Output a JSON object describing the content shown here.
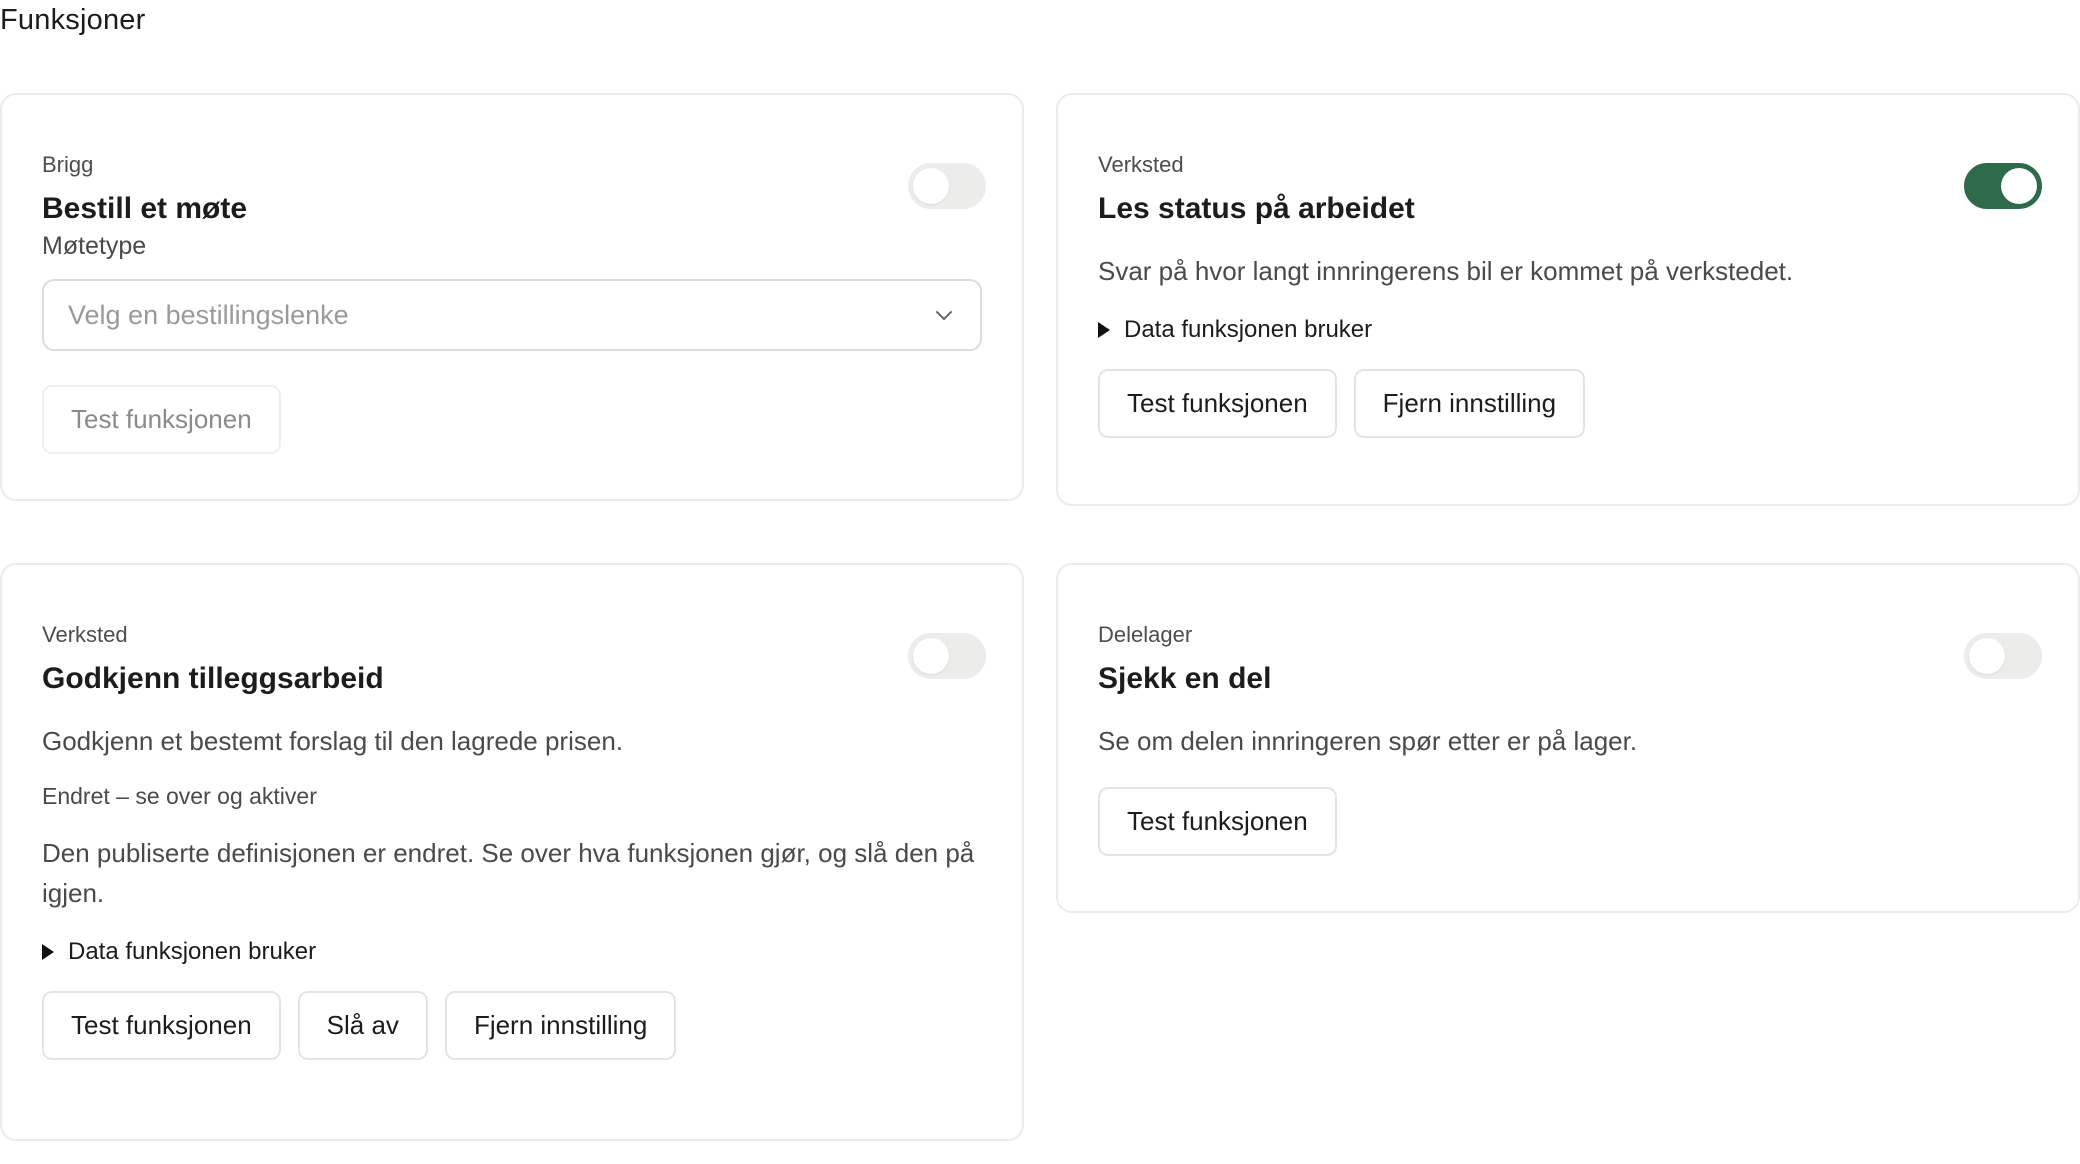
{
  "page": {
    "title": "Funksjoner"
  },
  "cards": [
    {
      "category": "Brigg",
      "title": "Bestill et møte",
      "enabled": false,
      "field_label": "Møtetype",
      "select_placeholder": "Velg en bestillingslenke",
      "buttons": [
        "Test funksjonen"
      ]
    },
    {
      "category": "Verksted",
      "title": "Les status på arbeidet",
      "enabled": true,
      "description": "Svar på hvor langt innringerens bil er kommet på verkstedet.",
      "data_toggle": "Data funksjonen bruker",
      "buttons": [
        "Test funksjonen",
        "Fjern innstilling"
      ]
    },
    {
      "category": "Verksted",
      "title": "Godkjenn tilleggsarbeid",
      "enabled": false,
      "description": "Godkjenn et bestemt forslag til den lagrede prisen.",
      "status_note": "Endret – se over og aktiver",
      "description_2": "Den publiserte definisjonen er endret. Se over hva funksjonen gjør, og slå den på igjen.",
      "data_toggle": "Data funksjonen bruker",
      "buttons": [
        "Test funksjonen",
        "Slå av",
        "Fjern innstilling"
      ]
    },
    {
      "category": "Delelager",
      "title": "Sjekk en del",
      "enabled": false,
      "description": "Se om delen innringeren spør etter er på lager.",
      "buttons": [
        "Test funksjonen"
      ]
    }
  ],
  "icons": {
    "dropdown": "chevron-down-icon",
    "disclosure": "triangle-right-icon"
  },
  "colors": {
    "toggle_on": "#2e6b4a",
    "toggle_off": "#ececea",
    "border": "#ececea"
  }
}
